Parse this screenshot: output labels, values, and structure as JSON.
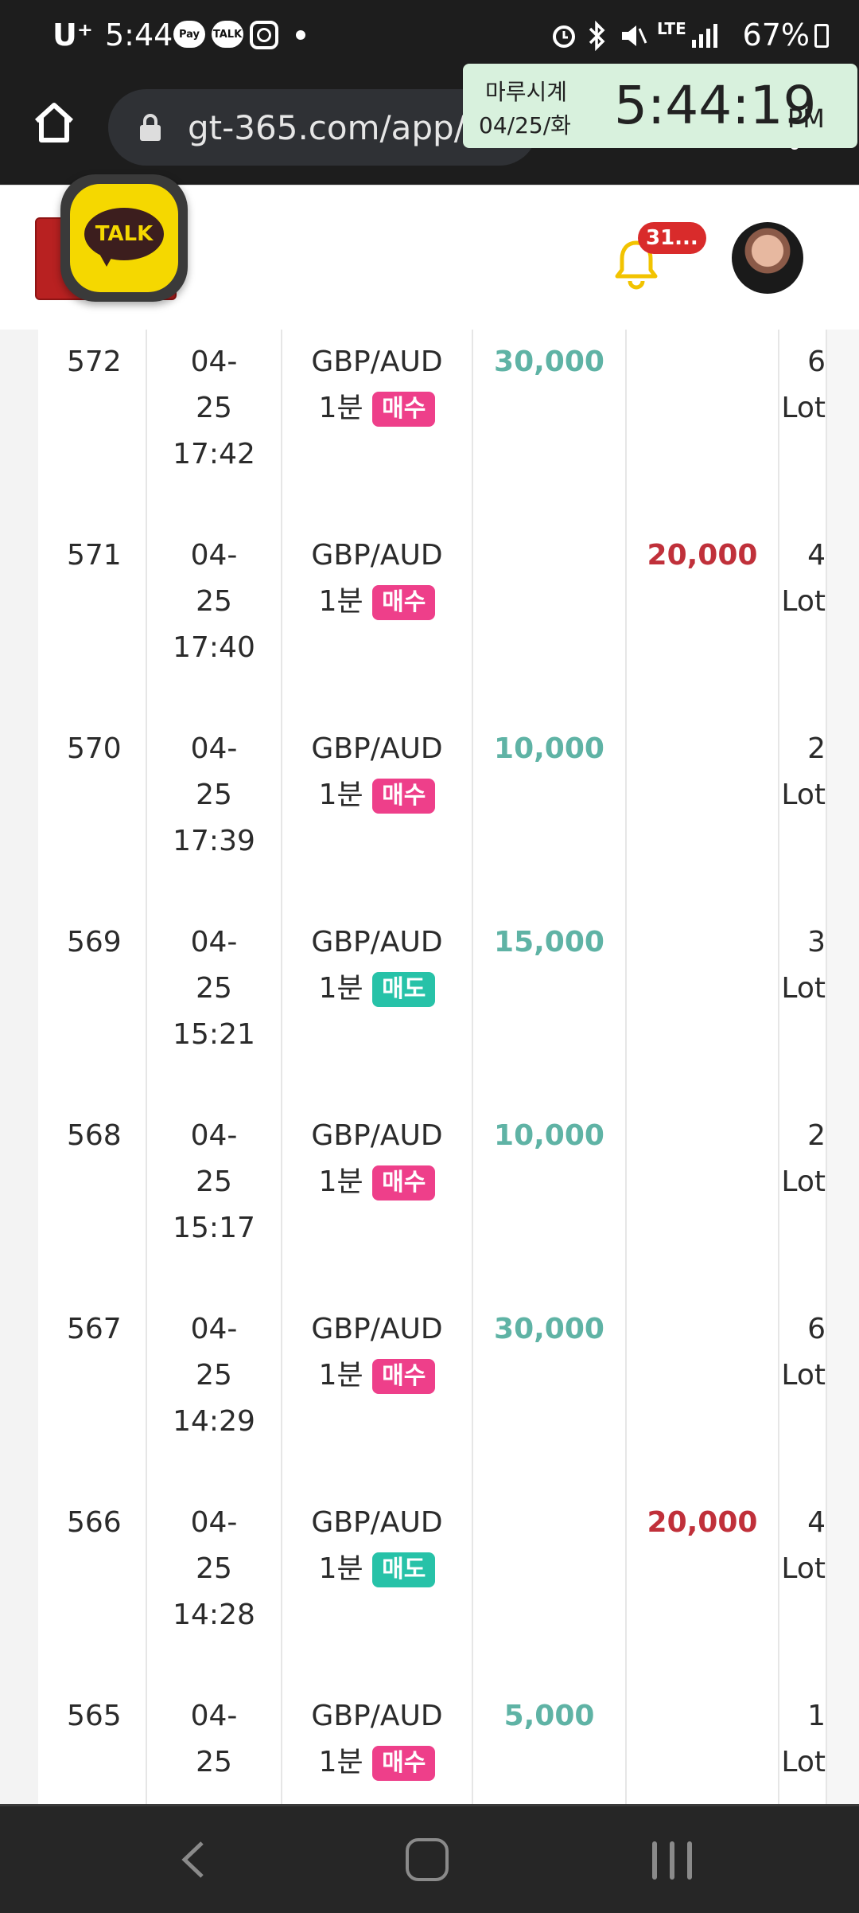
{
  "status_bar": {
    "carrier": "U⁺",
    "time": "5:44",
    "notification_icons": [
      "pay-icon",
      "talk-icon",
      "instagram-icon"
    ],
    "pay_label": "Pay",
    "talk_label": "TALK",
    "battery": "67%",
    "network": "LTE",
    "system_icons": [
      "alarm-icon",
      "bluetooth-icon",
      "mute-icon",
      "signal-icon"
    ]
  },
  "browser": {
    "url": "gt-365.com/app/t"
  },
  "clock_widget": {
    "name": "마루시계",
    "date": "04/25/화",
    "time": "5:44:19",
    "ampm": "PM"
  },
  "header": {
    "kakao_label": "TALK",
    "notification_count": "31..."
  },
  "colors": {
    "buy": "#ee3f8a",
    "sell": "#27c2a8",
    "profit": "#5fb3a5",
    "loss": "#c0303a"
  },
  "trades": [
    {
      "no": "572",
      "date": "04-",
      "day": "25",
      "time": "17:42",
      "symbol": "GBP/AUD",
      "period": "1분",
      "side": "매수",
      "side_type": "buy",
      "profit": "30,000",
      "loss": "",
      "lot_qty": "6",
      "lot_unit": "Lot"
    },
    {
      "no": "571",
      "date": "04-",
      "day": "25",
      "time": "17:40",
      "symbol": "GBP/AUD",
      "period": "1분",
      "side": "매수",
      "side_type": "buy",
      "profit": "",
      "loss": "20,000",
      "lot_qty": "4",
      "lot_unit": "Lot"
    },
    {
      "no": "570",
      "date": "04-",
      "day": "25",
      "time": "17:39",
      "symbol": "GBP/AUD",
      "period": "1분",
      "side": "매수",
      "side_type": "buy",
      "profit": "10,000",
      "loss": "",
      "lot_qty": "2",
      "lot_unit": "Lot"
    },
    {
      "no": "569",
      "date": "04-",
      "day": "25",
      "time": "15:21",
      "symbol": "GBP/AUD",
      "period": "1분",
      "side": "매도",
      "side_type": "sell",
      "profit": "15,000",
      "loss": "",
      "lot_qty": "3",
      "lot_unit": "Lot"
    },
    {
      "no": "568",
      "date": "04-",
      "day": "25",
      "time": "15:17",
      "symbol": "GBP/AUD",
      "period": "1분",
      "side": "매수",
      "side_type": "buy",
      "profit": "10,000",
      "loss": "",
      "lot_qty": "2",
      "lot_unit": "Lot"
    },
    {
      "no": "567",
      "date": "04-",
      "day": "25",
      "time": "14:29",
      "symbol": "GBP/AUD",
      "period": "1분",
      "side": "매수",
      "side_type": "buy",
      "profit": "30,000",
      "loss": "",
      "lot_qty": "6",
      "lot_unit": "Lot"
    },
    {
      "no": "566",
      "date": "04-",
      "day": "25",
      "time": "14:28",
      "symbol": "GBP/AUD",
      "period": "1분",
      "side": "매도",
      "side_type": "sell",
      "profit": "",
      "loss": "20,000",
      "lot_qty": "4",
      "lot_unit": "Lot"
    },
    {
      "no": "565",
      "date": "04-",
      "day": "25",
      "time": "",
      "symbol": "GBP/AUD",
      "period": "1분",
      "side": "매수",
      "side_type": "buy",
      "profit": "5,000",
      "loss": "",
      "lot_qty": "1",
      "lot_unit": "Lot"
    }
  ]
}
